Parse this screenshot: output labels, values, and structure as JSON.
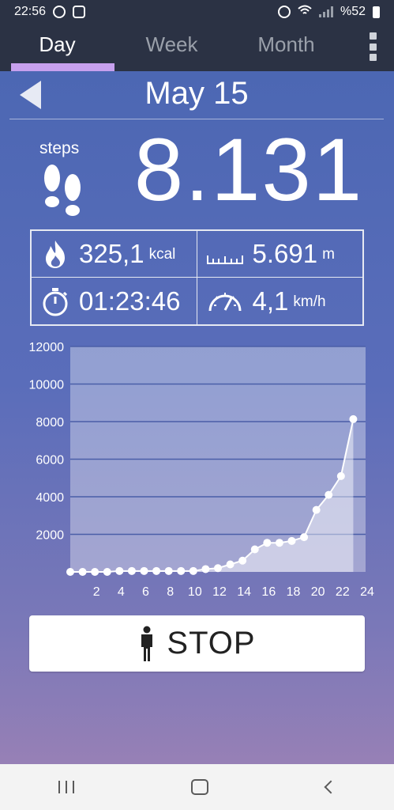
{
  "status_bar": {
    "time": "22:56",
    "battery": "%52"
  },
  "tabs": [
    {
      "label": "Day",
      "active": true
    },
    {
      "label": "Week",
      "active": false
    },
    {
      "label": "Month",
      "active": false
    }
  ],
  "header": {
    "date": "May 15"
  },
  "steps": {
    "label": "steps",
    "value": "8.131"
  },
  "stats": {
    "calories": {
      "value": "325,1",
      "unit": "kcal"
    },
    "distance": {
      "value": "5.691",
      "unit": "m"
    },
    "duration": {
      "value": "01:23:46"
    },
    "speed": {
      "value": "4,1",
      "unit": "km/h"
    }
  },
  "chart_data": {
    "type": "area",
    "ylim": [
      0,
      12000
    ],
    "xlim": [
      0,
      24
    ],
    "y_ticks": [
      2000,
      4000,
      6000,
      8000,
      10000,
      12000
    ],
    "x_ticks": [
      2,
      4,
      6,
      8,
      10,
      12,
      14,
      16,
      18,
      20,
      22,
      24
    ],
    "grid": true,
    "x": [
      0,
      1,
      2,
      3,
      4,
      5,
      6,
      7,
      8,
      9,
      10,
      11,
      12,
      13,
      14,
      15,
      16,
      17,
      18,
      19,
      20,
      21,
      22,
      23
    ],
    "values": [
      0,
      0,
      0,
      0,
      50,
      50,
      50,
      50,
      50,
      50,
      50,
      150,
      200,
      400,
      600,
      1200,
      1550,
      1550,
      1650,
      1850,
      3300,
      4100,
      5100,
      8131
    ]
  },
  "stop_button": {
    "label": "STOP"
  },
  "colors": {
    "tab_bar": "#2b3244",
    "tab_indicator": "#c7a0ee",
    "background_top": "#4c67b3",
    "background_bottom": "#9780b6"
  }
}
